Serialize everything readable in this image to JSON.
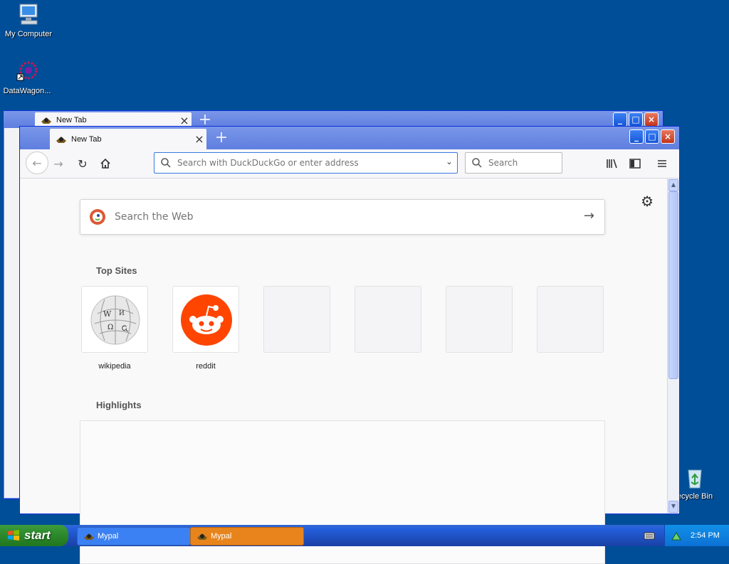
{
  "desktop": {
    "icons": [
      {
        "label": "My Computer"
      },
      {
        "label": "DataWagon..."
      },
      {
        "label": "ecycle Bin"
      }
    ]
  },
  "window_back": {
    "tab_title": "New Tab"
  },
  "window_front": {
    "tab_title": "New Tab",
    "url_placeholder": "Search with DuckDuckGo or enter address",
    "search_placeholder": "Search"
  },
  "newtab_page": {
    "search_placeholder": "Search the Web",
    "top_sites_title": "Top Sites",
    "top_sites": [
      {
        "label": "wikipedia"
      },
      {
        "label": "reddit"
      },
      {
        "label": ""
      },
      {
        "label": ""
      },
      {
        "label": ""
      },
      {
        "label": ""
      }
    ],
    "highlights_title": "Highlights"
  },
  "taskbar": {
    "start_label": "start",
    "tasks": [
      {
        "label": "Mypal",
        "active": false
      },
      {
        "label": "Mypal",
        "active": true
      }
    ],
    "clock": "2:54 PM"
  },
  "colors": {
    "desktop_bg": "#004e98",
    "reddit_orange": "#ff4500",
    "active_task": "#e8841c"
  }
}
